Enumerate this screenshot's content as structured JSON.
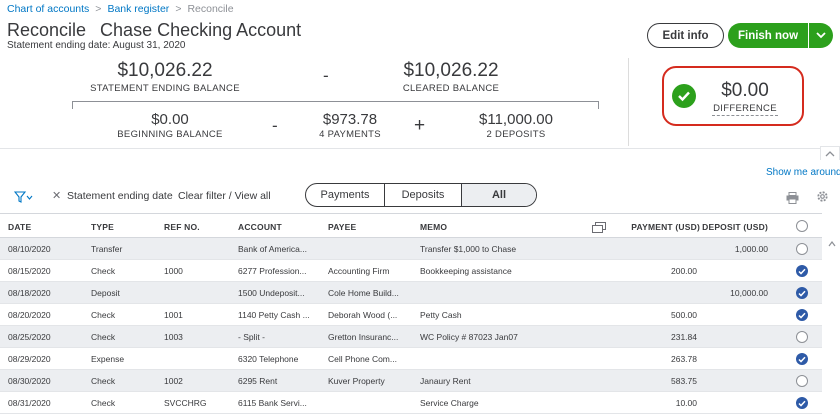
{
  "breadcrumb": {
    "chart_of_accounts": "Chart of accounts",
    "bank_register": "Bank register",
    "current": "Reconcile"
  },
  "header": {
    "title": "Reconcile",
    "account": "Chase Checking Account",
    "statement_date": "Statement ending date: August 31, 2020",
    "edit_label": "Edit info",
    "finish_label": "Finish now"
  },
  "summary": {
    "statement_ending_balance": "$10,026.22",
    "statement_ending_label": "STATEMENT ENDING BALANCE",
    "minus_sign": "-",
    "cleared_balance": "$10,026.22",
    "cleared_label": "CLEARED BALANCE",
    "beginning_balance": "$0.00",
    "beginning_label": "BEGINNING BALANCE",
    "minus_sign2": "-",
    "payments_total": "$973.78",
    "payments_label": "4 PAYMENTS",
    "plus_sign": "+",
    "deposits_total": "$11,000.00",
    "deposits_label": "2 DEPOSITS",
    "difference": "$0.00",
    "difference_label": "DIFFERENCE"
  },
  "toolbar": {
    "show_me_around": "Show me around",
    "filter_chip": "Statement ending date",
    "clear_filter": "Clear filter / View all",
    "tabs": [
      "Payments",
      "Deposits",
      "All"
    ],
    "selected_tab": "All"
  },
  "colors": {
    "brand_green": "#2ca01c",
    "link_blue": "#0077c5",
    "highlight_red": "#d52b1e",
    "check_blue": "#2e5aa7"
  },
  "table": {
    "headers": {
      "date": "DATE",
      "type": "TYPE",
      "ref": "REF NO.",
      "account": "ACCOUNT",
      "payee": "PAYEE",
      "memo": "MEMO",
      "payment": "PAYMENT (USD)",
      "deposit": "DEPOSIT (USD)"
    },
    "rows": [
      {
        "date": "08/10/2020",
        "type": "Transfer",
        "ref": "",
        "account": "Bank of America...",
        "payee": "",
        "memo": "Transfer $1,000 to Chase",
        "payment": "",
        "deposit": "1,000.00",
        "cleared": false
      },
      {
        "date": "08/15/2020",
        "type": "Check",
        "ref": "1000",
        "account": "6277 Profession...",
        "payee": "Accounting Firm",
        "memo": "Bookkeeping assistance",
        "payment": "200.00",
        "deposit": "",
        "cleared": true
      },
      {
        "date": "08/18/2020",
        "type": "Deposit",
        "ref": "",
        "account": "1500 Undeposit...",
        "payee": "Cole Home Build...",
        "memo": "",
        "payment": "",
        "deposit": "10,000.00",
        "cleared": true
      },
      {
        "date": "08/20/2020",
        "type": "Check",
        "ref": "1001",
        "account": "1140 Petty Cash ...",
        "payee": "Deborah Wood (...",
        "memo": "Petty Cash",
        "payment": "500.00",
        "deposit": "",
        "cleared": true
      },
      {
        "date": "08/25/2020",
        "type": "Check",
        "ref": "1003",
        "account": "- Split -",
        "payee": "Gretton Insuranc...",
        "memo": "WC Policy # 87023 Jan07",
        "payment": "231.84",
        "deposit": "",
        "cleared": false
      },
      {
        "date": "08/29/2020",
        "type": "Expense",
        "ref": "",
        "account": "6320 Telephone",
        "payee": "Cell Phone Com...",
        "memo": "",
        "payment": "263.78",
        "deposit": "",
        "cleared": true
      },
      {
        "date": "08/30/2020",
        "type": "Check",
        "ref": "1002",
        "account": "6295 Rent",
        "payee": "Kuver Property",
        "memo": "Janaury Rent",
        "payment": "583.75",
        "deposit": "",
        "cleared": false
      },
      {
        "date": "08/31/2020",
        "type": "Check",
        "ref": "SVCCHRG",
        "account": "6115 Bank Servi...",
        "payee": "",
        "memo": "Service Charge",
        "payment": "10.00",
        "deposit": "",
        "cleared": true
      }
    ]
  }
}
